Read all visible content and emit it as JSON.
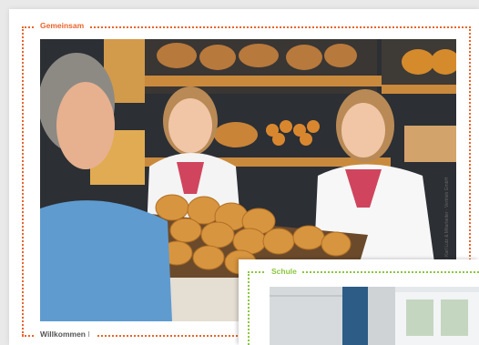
{
  "sections": {
    "gemeinsam_label": "Gemeinsam",
    "willkommen_label": "Willkommen",
    "schule_label": "Schule"
  },
  "photo_credit": "Karl Lutz & Mitarbeiter · Vertrieb GmbH",
  "source_tag": "iStock",
  "colors": {
    "accent_orange": "#e9642a",
    "accent_green": "#8cc63f"
  }
}
